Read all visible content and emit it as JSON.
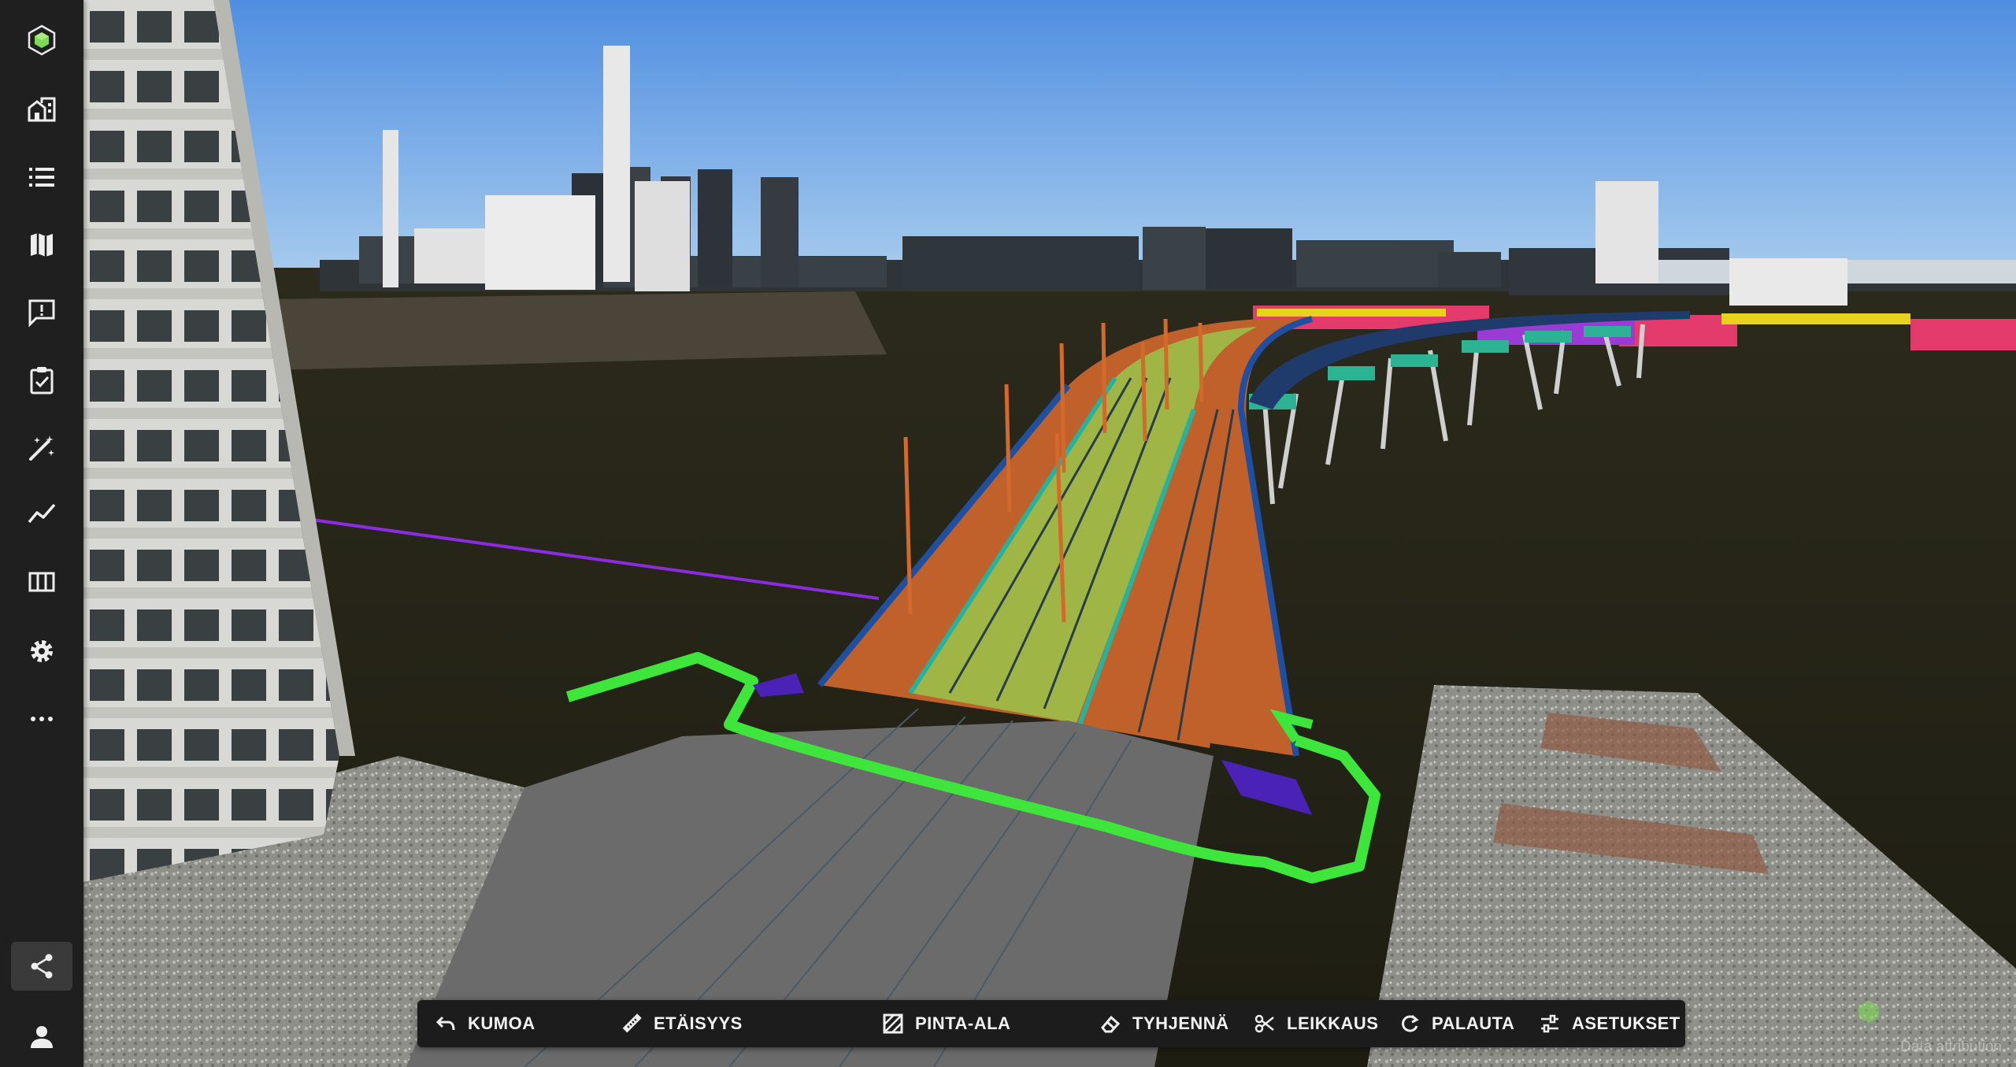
{
  "app": {
    "brand_icon": "hexagon-cube-logo-icon",
    "accent_color": "#7ed957"
  },
  "sidebar": {
    "items": [
      {
        "name": "home-city-icon"
      },
      {
        "name": "list-icon"
      },
      {
        "name": "map-icon"
      },
      {
        "name": "feedback-icon"
      },
      {
        "name": "clipboard-check-icon"
      },
      {
        "name": "magic-wand-icon"
      },
      {
        "name": "line-chart-icon"
      },
      {
        "name": "table-columns-icon"
      },
      {
        "name": "gear-icon"
      },
      {
        "name": "more-horizontal-icon"
      }
    ],
    "bottom": [
      {
        "name": "share-icon",
        "active": true
      },
      {
        "name": "user-icon"
      }
    ]
  },
  "toolbar": {
    "undo_label": "KUMOA",
    "distance_label": "ETÄISYYS",
    "area_label": "PINTA-ALA",
    "clear_label": "TYHJENNÄ",
    "clip_label": "LEIKKAUS",
    "reset_label": "PALAUTA",
    "settings_label": "ASETUKSET"
  },
  "footer": {
    "attribution": "Data attribution"
  }
}
